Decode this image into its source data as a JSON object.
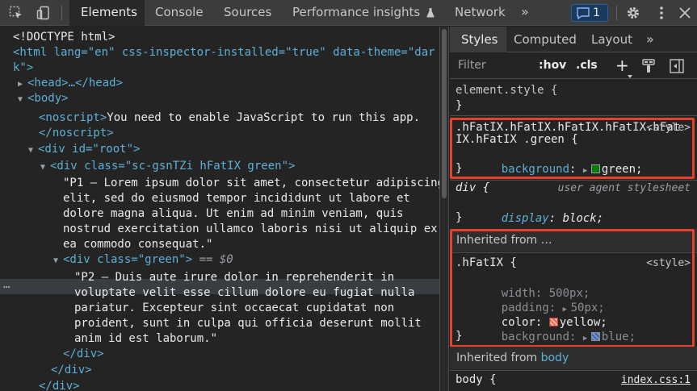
{
  "toolbar": {
    "tabs": [
      {
        "label": "Elements"
      },
      {
        "label": "Console"
      },
      {
        "label": "Sources"
      },
      {
        "label": "Performance insights"
      },
      {
        "label": "Network"
      }
    ],
    "more": "»",
    "issues_count": "1"
  },
  "dom": {
    "doctype": "<!DOCTYPE html>",
    "html_open_1": "<html lang=\"en\" css-inspector-installed=\"true\" data-theme=\"dar",
    "html_open_2": "k\">",
    "head": "<head>…</head>",
    "body": "<body>",
    "noscript_open": "<noscript>",
    "noscript_text": "You need to enable JavaScript to run this app.",
    "noscript_close": "</noscript>",
    "div_root": "<div id=\"root\">",
    "div_class": "<div class=\"sc-gsnTZi hFatIX green\">",
    "p1": [
      "\"P1 – Lorem ipsum dolor sit amet, consectetur adipiscing",
      "elit, sed do eiusmod tempor incididunt ut labore et",
      "dolore magna aliqua. Ut enim ad minim veniam, quis",
      "nostrud exercitation ullamco laboris nisi ut aliquip ex",
      "ea commodo consequat.\""
    ],
    "div_green": "<div class=\"green\">",
    "selected_marker": "== $0",
    "p2": [
      "\"P2 – Duis aute irure dolor in reprehenderit in",
      "voluptate velit esse cillum dolore eu fugiat nulla",
      "pariatur. Excepteur sint occaecat cupidatat non",
      "proident, sunt in culpa qui officia deserunt mollit",
      "anim id est laborum.\""
    ],
    "close_div_1": "</div>",
    "close_div_2": "</div>",
    "close_div_3": "</div>",
    "ellipsis": "…"
  },
  "styles": {
    "tabs": [
      {
        "label": "Styles"
      },
      {
        "label": "Computed"
      },
      {
        "label": "Layout"
      }
    ],
    "more": "»",
    "filter_placeholder": "Filter",
    "hov": ":hov",
    "cls": ".cls",
    "add": "+",
    "element_style": "element.style {",
    "close_brace": "}",
    "rule1": {
      "selector_1": ".hFatIX.hFatIX.hFatIX.hFatIX.hFat",
      "selector_2": "IX.hFatIX .green {",
      "source": "<style>",
      "prop": "background",
      "value": "green;"
    },
    "rule2": {
      "selector": "div {",
      "source": "user agent stylesheet",
      "prop": "display",
      "value": "block;"
    },
    "inherited_from": "Inherited from …",
    "rule3": {
      "selector": ".hFatIX {",
      "source": "<style>",
      "props": [
        {
          "name": "width",
          "value": "500px;",
          "inherited": false
        },
        {
          "name": "padding",
          "value": "50px;",
          "inherited": false
        },
        {
          "name": "color",
          "value": "yellow;",
          "inherited": true
        },
        {
          "name": "background",
          "value": "blue;",
          "inherited": false
        }
      ]
    },
    "inherited_from_body": "Inherited from ",
    "body_word": "body",
    "rule4": {
      "selector": "body {",
      "source": "index.css:1"
    }
  },
  "colors": {
    "green_swatch": "#008000",
    "yellow_swatch": "#ffff00",
    "blue_swatch": "#0000ff",
    "highlight_box": "#e8412b"
  }
}
